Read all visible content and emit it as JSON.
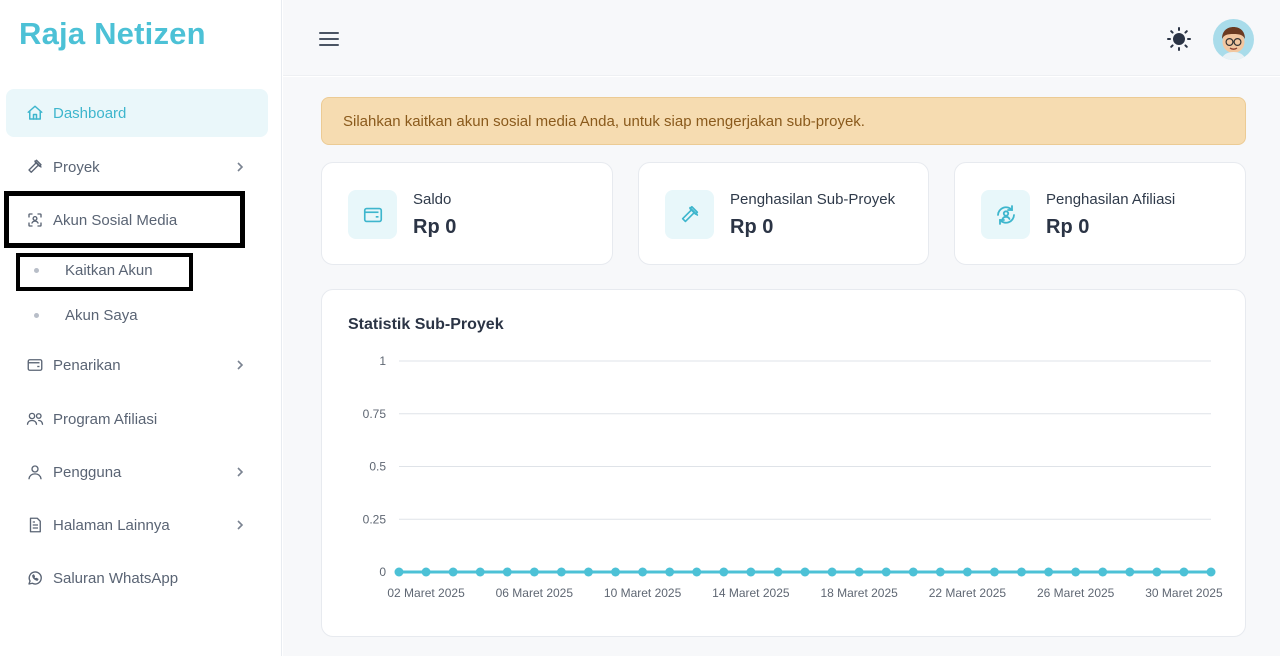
{
  "app": {
    "brand": "Raja Netizen"
  },
  "sidebar": {
    "items": [
      {
        "label": "Dashboard",
        "icon": "home-icon",
        "active": true
      },
      {
        "label": "Proyek",
        "icon": "hammer-icon",
        "has_children": true
      },
      {
        "label": "Akun Sosial Media",
        "icon": "user-scan-icon"
      },
      {
        "label": "Penarikan",
        "icon": "wallet-icon",
        "has_children": true
      },
      {
        "label": "Program Afiliasi",
        "icon": "users-icon"
      },
      {
        "label": "Pengguna",
        "icon": "user-icon",
        "has_children": true
      },
      {
        "label": "Halaman Lainnya",
        "icon": "file-icon",
        "has_children": true
      },
      {
        "label": "Saluran WhatsApp",
        "icon": "whatsapp-icon"
      }
    ],
    "sub_items": [
      {
        "label": "Kaitkan Akun"
      },
      {
        "label": "Akun Saya"
      }
    ]
  },
  "topbar": {
    "menu_icon": "hamburger-icon",
    "theme_icon": "sun-icon",
    "avatar_icon": "avatar"
  },
  "alert": {
    "text": "Silahkan kaitkan akun sosial media Anda, untuk siap mengerjakan sub-proyek."
  },
  "stats": [
    {
      "label": "Saldo",
      "value": "Rp 0",
      "icon": "wallet-icon"
    },
    {
      "label": "Penghasilan Sub-Proyek",
      "value": "Rp 0",
      "icon": "hammer-icon"
    },
    {
      "label": "Penghasilan Afiliasi",
      "value": "Rp 0",
      "icon": "refresh-user-icon"
    }
  ],
  "chart": {
    "title": "Statistik Sub-Proyek"
  },
  "chart_data": {
    "type": "line",
    "title": "Statistik Sub-Proyek",
    "xlabel": "",
    "ylabel": "",
    "ylim": [
      0,
      1
    ],
    "yticks": [
      "0",
      "0.25",
      "0.5",
      "0.75",
      "1"
    ],
    "x": [
      "01 Maret 2025",
      "02 Maret 2025",
      "03 Maret 2025",
      "04 Maret 2025",
      "05 Maret 2025",
      "06 Maret 2025",
      "07 Maret 2025",
      "08 Maret 2025",
      "09 Maret 2025",
      "10 Maret 2025",
      "11 Maret 2025",
      "12 Maret 2025",
      "13 Maret 2025",
      "14 Maret 2025",
      "15 Maret 2025",
      "16 Maret 2025",
      "17 Maret 2025",
      "18 Maret 2025",
      "19 Maret 2025",
      "20 Maret 2025",
      "21 Maret 2025",
      "22 Maret 2025",
      "23 Maret 2025",
      "24 Maret 2025",
      "25 Maret 2025",
      "26 Maret 2025",
      "27 Maret 2025",
      "28 Maret 2025",
      "29 Maret 2025",
      "30 Maret 2025",
      "31 Maret 2025"
    ],
    "xticks_shown": [
      "02 Maret 2025",
      "06 Maret 2025",
      "10 Maret 2025",
      "14 Maret 2025",
      "18 Maret 2025",
      "22 Maret 2025",
      "26 Maret 2025",
      "30 Maret 2025"
    ],
    "series": [
      {
        "values": [
          0,
          0,
          0,
          0,
          0,
          0,
          0,
          0,
          0,
          0,
          0,
          0,
          0,
          0,
          0,
          0,
          0,
          0,
          0,
          0,
          0,
          0,
          0,
          0,
          0,
          0,
          0,
          0,
          0,
          0,
          0
        ]
      }
    ],
    "grid": true,
    "color": "#4cc1d6"
  }
}
